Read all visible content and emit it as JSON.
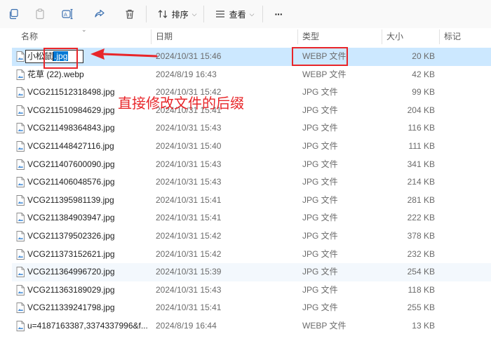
{
  "toolbar": {
    "sort_label": "排序",
    "view_label": "查看",
    "more_label": "···"
  },
  "columns": {
    "name": "名称",
    "date": "日期",
    "type": "类型",
    "size": "大小",
    "tag": "标记"
  },
  "rename": {
    "prefix": "小松鼠",
    "selected_ext": ".jpg"
  },
  "annotation": {
    "text": "直接修改文件的后缀"
  },
  "files": [
    {
      "name": "",
      "date": "2024/10/31 15:46",
      "type": "WEBP 文件",
      "size": "20 KB"
    },
    {
      "name": "花草 (22).webp",
      "date": "2024/8/19 16:43",
      "type": "WEBP 文件",
      "size": "42 KB"
    },
    {
      "name": "VCG211512318498.jpg",
      "date": "2024/10/31 15:42",
      "type": "JPG 文件",
      "size": "99 KB"
    },
    {
      "name": "VCG211510984629.jpg",
      "date": "2024/10/31 15:41",
      "type": "JPG 文件",
      "size": "204 KB"
    },
    {
      "name": "VCG211498364843.jpg",
      "date": "2024/10/31 15:43",
      "type": "JPG 文件",
      "size": "116 KB"
    },
    {
      "name": "VCG211448427116.jpg",
      "date": "2024/10/31 15:40",
      "type": "JPG 文件",
      "size": "111 KB"
    },
    {
      "name": "VCG211407600090.jpg",
      "date": "2024/10/31 15:43",
      "type": "JPG 文件",
      "size": "341 KB"
    },
    {
      "name": "VCG211406048576.jpg",
      "date": "2024/10/31 15:43",
      "type": "JPG 文件",
      "size": "214 KB"
    },
    {
      "name": "VCG211395981139.jpg",
      "date": "2024/10/31 15:41",
      "type": "JPG 文件",
      "size": "281 KB"
    },
    {
      "name": "VCG211384903947.jpg",
      "date": "2024/10/31 15:41",
      "type": "JPG 文件",
      "size": "222 KB"
    },
    {
      "name": "VCG211379502326.jpg",
      "date": "2024/10/31 15:42",
      "type": "JPG 文件",
      "size": "378 KB"
    },
    {
      "name": "VCG211373152621.jpg",
      "date": "2024/10/31 15:42",
      "type": "JPG 文件",
      "size": "232 KB"
    },
    {
      "name": "VCG211364996720.jpg",
      "date": "2024/10/31 15:39",
      "type": "JPG 文件",
      "size": "254 KB"
    },
    {
      "name": "VCG211363189029.jpg",
      "date": "2024/10/31 15:43",
      "type": "JPG 文件",
      "size": "118 KB"
    },
    {
      "name": "VCG211339241798.jpg",
      "date": "2024/10/31 15:41",
      "type": "JPG 文件",
      "size": "255 KB"
    },
    {
      "name": "u=4187163387,3374337996&f...",
      "date": "2024/8/19 16:44",
      "type": "WEBP 文件",
      "size": "13 KB"
    }
  ],
  "colors": {
    "selected_row": "#cce8ff",
    "hover_row": "#f3f8fd",
    "annotation_red": "#e8262a",
    "selection_blue": "#0078d4"
  }
}
